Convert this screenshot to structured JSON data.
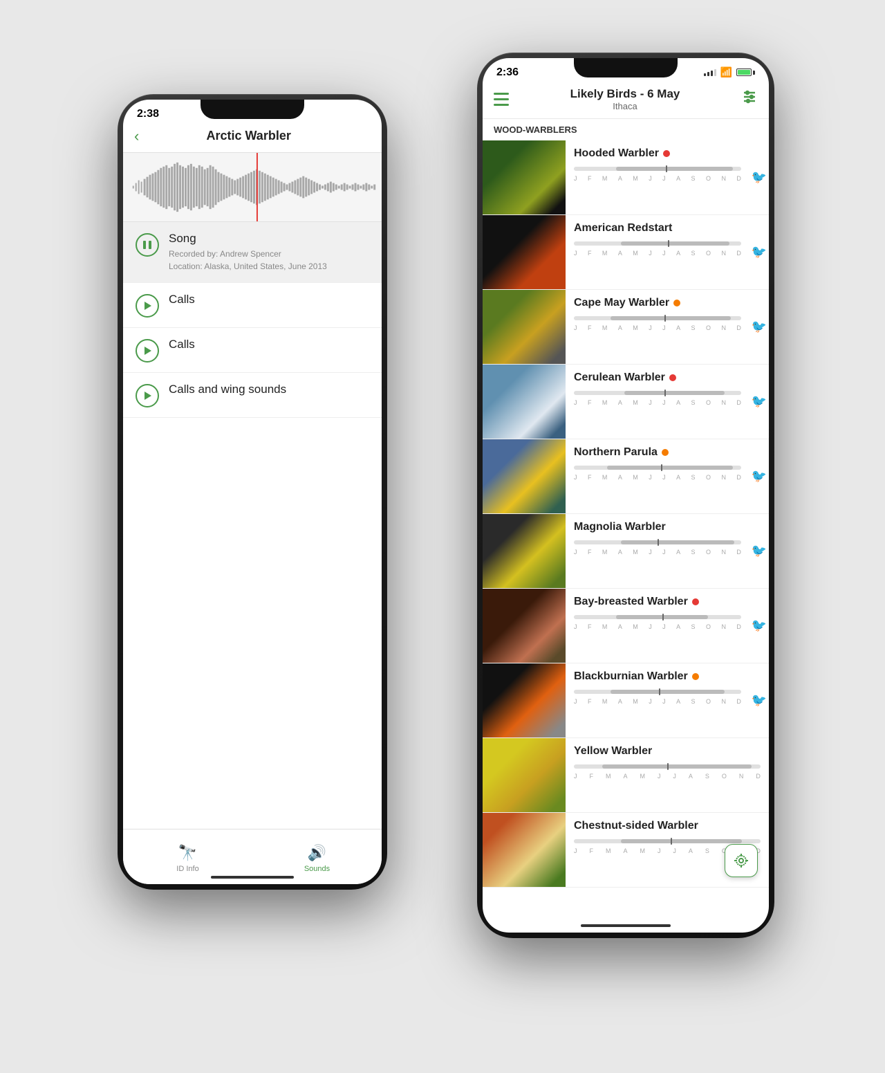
{
  "scene": {
    "background": "#e8e8e8"
  },
  "phone1": {
    "status_time": "2:38",
    "title": "Arctic Warbler",
    "sounds": [
      {
        "id": "song",
        "label": "Song",
        "active": true,
        "meta_line1": "Recorded by: Andrew Spencer",
        "meta_line2": "Location: Alaska, United States, June 2013",
        "has_meta": true
      },
      {
        "id": "calls1",
        "label": "Calls",
        "active": false,
        "has_meta": false
      },
      {
        "id": "calls2",
        "label": "Calls",
        "active": false,
        "has_meta": false
      },
      {
        "id": "calls_wing",
        "label": "Calls and wing sounds",
        "active": false,
        "has_meta": false
      }
    ],
    "tabs": [
      {
        "id": "id-info",
        "label": "ID Info",
        "active": false,
        "icon": "🔭"
      },
      {
        "id": "sounds",
        "label": "Sounds",
        "active": true,
        "icon": "🔊"
      }
    ]
  },
  "phone2": {
    "status_time": "2:36",
    "header_title": "Likely Birds - 6 May",
    "header_subtitle": "Ithaca",
    "section_label": "WOOD-WARBLERS",
    "birds": [
      {
        "name": "Hooded Warbler",
        "dot": "red",
        "photo_class": "bird-hooded",
        "peak_pct": 55,
        "fill_start": 25,
        "fill_width": 70
      },
      {
        "name": "American Redstart",
        "dot": "none",
        "photo_class": "bird-redstart",
        "peak_pct": 56,
        "fill_start": 28,
        "fill_width": 65
      },
      {
        "name": "Cape May Warbler",
        "dot": "orange",
        "photo_class": "bird-capemay",
        "peak_pct": 54,
        "fill_start": 22,
        "fill_width": 72
      },
      {
        "name": "Cerulean Warbler",
        "dot": "red",
        "photo_class": "bird-cerulean",
        "peak_pct": 54,
        "fill_start": 30,
        "fill_width": 60
      },
      {
        "name": "Northern Parula",
        "dot": "orange",
        "photo_class": "bird-parula",
        "peak_pct": 52,
        "fill_start": 20,
        "fill_width": 75
      },
      {
        "name": "Magnolia Warbler",
        "dot": "none",
        "photo_class": "bird-magnolia",
        "peak_pct": 50,
        "fill_start": 28,
        "fill_width": 68
      },
      {
        "name": "Bay-breasted Warbler",
        "dot": "red",
        "photo_class": "bird-baybreasted",
        "peak_pct": 53,
        "fill_start": 25,
        "fill_width": 55
      },
      {
        "name": "Blackburnian Warbler",
        "dot": "orange",
        "photo_class": "bird-blackburnian",
        "peak_pct": 51,
        "fill_start": 22,
        "fill_width": 68
      },
      {
        "name": "Yellow Warbler",
        "dot": "none",
        "photo_class": "bird-yellow",
        "peak_pct": 50,
        "fill_start": 15,
        "fill_width": 80
      },
      {
        "name": "Chestnut-sided Warbler",
        "dot": "none",
        "photo_class": "bird-chestnut",
        "peak_pct": 52,
        "fill_start": 25,
        "fill_width": 65
      }
    ],
    "month_labels": [
      "J",
      "F",
      "M",
      "A",
      "M",
      "J",
      "J",
      "A",
      "S",
      "O",
      "N",
      "D"
    ]
  }
}
